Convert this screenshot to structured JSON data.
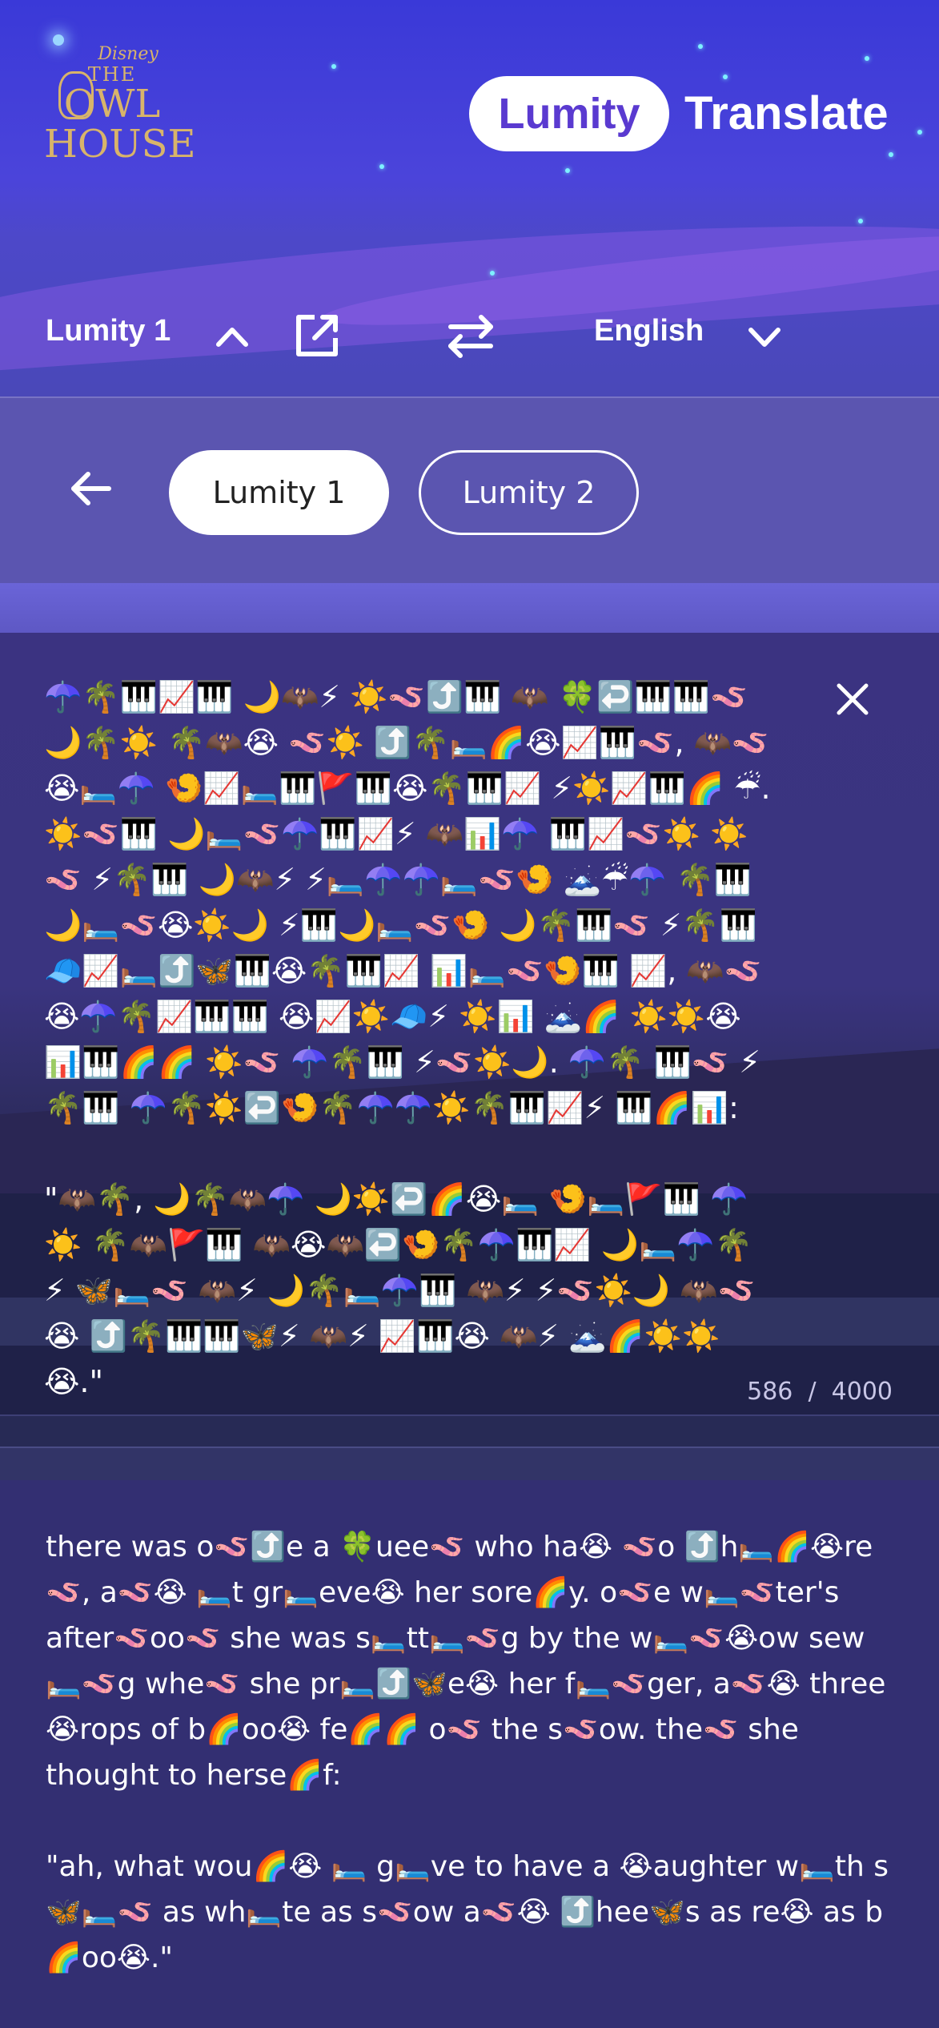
{
  "header": {
    "logo": {
      "disney": "Disney",
      "the": "THE",
      "owl": "OWL",
      "house": "HOUSE"
    },
    "brand_pill": "Lumity",
    "brand_word": "Translate"
  },
  "language_bar": {
    "source_language": "Lumity 1",
    "target_language": "English",
    "icons": [
      "chevron-up-icon",
      "external-link-icon",
      "swap-icon",
      "chevron-down-icon"
    ]
  },
  "dialects": {
    "back_icon": "back-arrow-icon",
    "options": [
      "Lumity 1",
      "Lumity 2"
    ],
    "selected": "Lumity 1"
  },
  "input": {
    "text": "☂️🌴🎹📈🎹 🌙🦇⚡ ☀️🪱⤴️🎹 🦇 🍀↩️🎹🎹🪱 🌙🌴☀️ 🌴🦇😭 🪱☀️ ⤴️🌴🛏️🌈😭📈🎹🪱, 🦇🪱 😭🛏️☂️ 🍤📈🛏️🎹🚩🎹😭🌴🎹📈 ⚡☀️📈🎹🌈 ☔. ☀️🪱🎹 🌙🛏️🪱☂️🎹📈⚡ 🦇📊☂️ 🎹📈🪱☀️ ☀️🪱 ⚡🌴🎹 🌙🦇⚡ ⚡🛏️☂️☂️🛏️🪱🍤 🗻☔☂️ 🌴🎹 🌙🛏️🪱😭☀️🌙 ⚡🎹🌙🛏️🪱🍤 🌙🌴🎹🪱 ⚡🌴🎹 🧢📈🛏️⤴️🦋🎹😭🌴🎹📈 📊🛏️🪱🍤🎹 📈, 🦇🪱😭☂️🌴📈🎹🎹 😭📈☀️🧢⚡ ☀️📊 🗻🌈 ☀️☀️😭 📊🎹🌈🌈 ☀️🪱 ☂️🌴🎹 ⚡🪱☀️🌙. ☂️🌴 🎹🪱 ⚡🌴🎹 ☂️🌴☀️↩️🍤🌴☂️☂️☀️🌴🎹📈⚡ 🎹🌈📊:\n\n\"🦇🌴, 🌙🌴🦇☂️ 🌙☀️↩️🌈😭🛏️ 🍤🛏️🚩🎹 ☂️☀️ 🌴🦇🚩🎹 🦇😭🦇↩️🍤🌴☂️🎹📈 🌙🛏️☂️🌴 ⚡ 🦋🛏️🪱 🦇⚡ 🌙🌴🛏️☂️🎹 🦇⚡ ⚡🪱☀️🌙 🦇🪱 😭 ⤴️🌴🎹🎹🦋⚡ 🦇⚡ 📈🎹😭 🦇⚡ 🗻🌈☀️☀️ 😭.\""
  },
  "counter": {
    "current": "586",
    "separator": "/",
    "max": "4000"
  },
  "output": {
    "text": "there was o🪱⤴️e a 🍀uee🪱 who ha😭 🪱o ⤴️h🛏️🌈😭re 🪱, a🪱😭 🛏️t gr🛏️eve😭 her sore🌈y. o🪱e w🛏️🪱ter's after🪱oo🪱 she was s🛏️tt🛏️🪱g by the w🛏️🪱😭ow sew 🛏️🪱g whe🪱 she pr🛏️⤴️🦋e😭 her f🛏️🪱ger, a🪱😭 three 😭rops of b🌈oo😭 fe🌈🌈 o🪱 the s🪱ow. the🪱 she thought to herse🌈f:\n\n\"ah, what wou🌈😭 🛏️ g🛏️ve to have a 😭aughter w🛏️th s 🦋🛏️🪱 as wh🛏️te as s🪱ow a🪱😭 ⤴️hee🦋s as re😭 as b🌈oo😭.\""
  },
  "colors": {
    "header_bg": "#3a39d8",
    "dialect_bar_bg": "#5b55b0",
    "input_bg": "#3b3381",
    "output_bg": "#332f72",
    "brand_purple": "#5a3ad0",
    "logo_gold": "#d8b46a"
  }
}
